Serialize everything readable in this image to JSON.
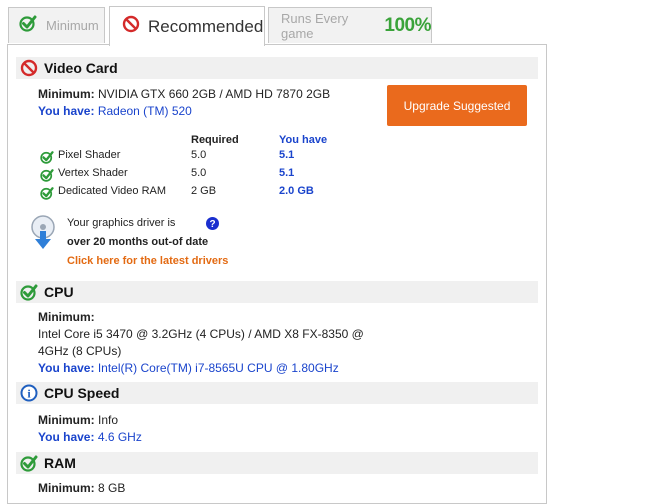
{
  "tabs": {
    "minimum": "Minimum",
    "recommended": "Recommended",
    "runs_every_game": "Runs Every game",
    "runs_percent": "100%"
  },
  "video_card": {
    "title": "Video Card",
    "minimum_label": "Minimum:",
    "minimum_value": "NVIDIA GTX 660 2GB / AMD HD 7870 2GB",
    "you_have_label": "You have:",
    "you_have_value": "Radeon (TM) 520",
    "upgrade_button": "Upgrade Suggested",
    "table": {
      "col_required": "Required",
      "col_you_have": "You have",
      "rows": [
        {
          "name": "Pixel Shader",
          "required": "5.0",
          "you_have": "5.1"
        },
        {
          "name": "Vertex Shader",
          "required": "5.0",
          "you_have": "5.1"
        },
        {
          "name": "Dedicated Video RAM",
          "required": "2 GB",
          "you_have": "2.0 GB"
        }
      ]
    },
    "driver_line1": "Your graphics driver is",
    "driver_line2": "over 20 months out-of date",
    "driver_link": "Click here for the latest drivers",
    "help_glyph": "?"
  },
  "cpu": {
    "title": "CPU",
    "minimum_label": "Minimum:",
    "minimum_line1": "Intel Core i5 3470 @ 3.2GHz (4 CPUs) / AMD X8 FX-8350 @",
    "minimum_line2": "4GHz (8 CPUs)",
    "you_have_label": "You have:",
    "you_have_value": "Intel(R) Core(TM) i7-8565U CPU @ 1.80GHz"
  },
  "cpu_speed": {
    "title": "CPU Speed",
    "minimum_label": "Minimum:",
    "minimum_value": "Info",
    "you_have_label": "You have:",
    "you_have_value": "4.6 GHz",
    "info_glyph": "i"
  },
  "ram": {
    "title": "RAM",
    "minimum_label": "Minimum:",
    "minimum_value": "8 GB"
  },
  "colors": {
    "pass_green": "#2e9b3a",
    "fail_red": "#d42a2a",
    "link_blue": "#1a44cc",
    "upgrade_orange": "#ea6a1d",
    "info_blue": "#1f5fbf"
  }
}
